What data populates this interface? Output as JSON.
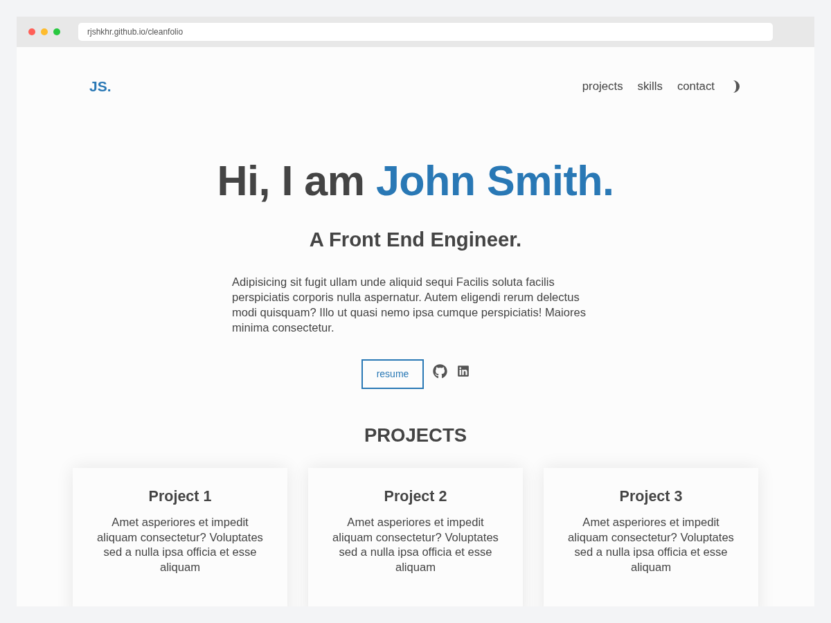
{
  "browser": {
    "url": "rjshkhr.github.io/cleanfolio"
  },
  "header": {
    "logo": "JS.",
    "nav": [
      "projects",
      "skills",
      "contact"
    ]
  },
  "hero": {
    "greeting": "Hi, I am",
    "name": "John Smith.",
    "role": "A Front End Engineer.",
    "description": "Adipisicing sit fugit ullam unde aliquid sequi Facilis soluta facilis perspiciatis corporis nulla aspernatur. Autem eligendi rerum delectus modi quisquam? Illo ut quasi nemo ipsa cumque perspiciatis! Maiores minima consectetur.",
    "resume_button": "resume"
  },
  "projects": {
    "heading": "PROJECTS",
    "cards": [
      {
        "title": "Project 1",
        "description": "Amet asperiores et impedit aliquam consectetur? Voluptates sed a nulla ipsa officia et esse aliquam"
      },
      {
        "title": "Project 2",
        "description": "Amet asperiores et impedit aliquam consectetur? Voluptates sed a nulla ipsa officia et esse aliquam"
      },
      {
        "title": "Project 3",
        "description": "Amet asperiores et impedit aliquam consectetur? Voluptates sed a nulla ipsa officia et esse aliquam"
      }
    ]
  }
}
